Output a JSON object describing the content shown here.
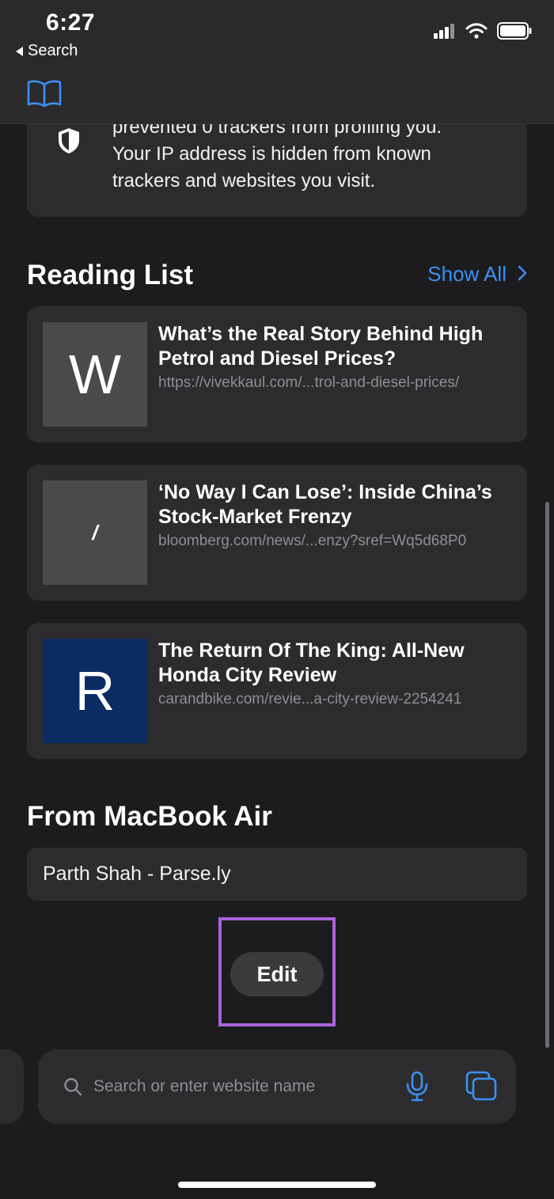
{
  "status_bar": {
    "time": "6:27",
    "back_label": "Search"
  },
  "privacy": {
    "lines": [
      "prevented 0 trackers from profiling you.",
      "Your IP address is hidden from known",
      "trackers and websites you visit."
    ]
  },
  "reading_list": {
    "title": "Reading List",
    "show_all": "Show All",
    "items": [
      {
        "thumb_letter": "W",
        "title": "What’s the Real Story Behind High Petrol and Diesel Prices?",
        "url": "https://vivekkaul.com/...trol-and-diesel-prices/"
      },
      {
        "thumb_letter": "/",
        "title": "‘No Way I Can Lose’: Inside China’s Stock-Market Frenzy",
        "url": "bloomberg.com/news/...enzy?sref=Wq5d68P0"
      },
      {
        "thumb_letter": "R",
        "title": "The Return Of The King: All-New Honda City Review",
        "url": "carandbike.com/revie...a-city-review-2254241"
      }
    ]
  },
  "from_device": {
    "title": "From MacBook Air",
    "items": [
      {
        "label": "Parth Shah - Parse.ly"
      }
    ]
  },
  "edit_label": "Edit",
  "search": {
    "placeholder": "Search or enter website name",
    "value": ""
  },
  "colors": {
    "accent": "#3d8ff5",
    "highlight": "#a962de",
    "background": "#1c1c1e",
    "card": "#2c2c2e"
  },
  "icons": {
    "bookmarks": "book-icon",
    "privacy": "shield-icon",
    "search": "search-icon",
    "voice": "mic-icon",
    "tabs": "tabs-icon"
  }
}
